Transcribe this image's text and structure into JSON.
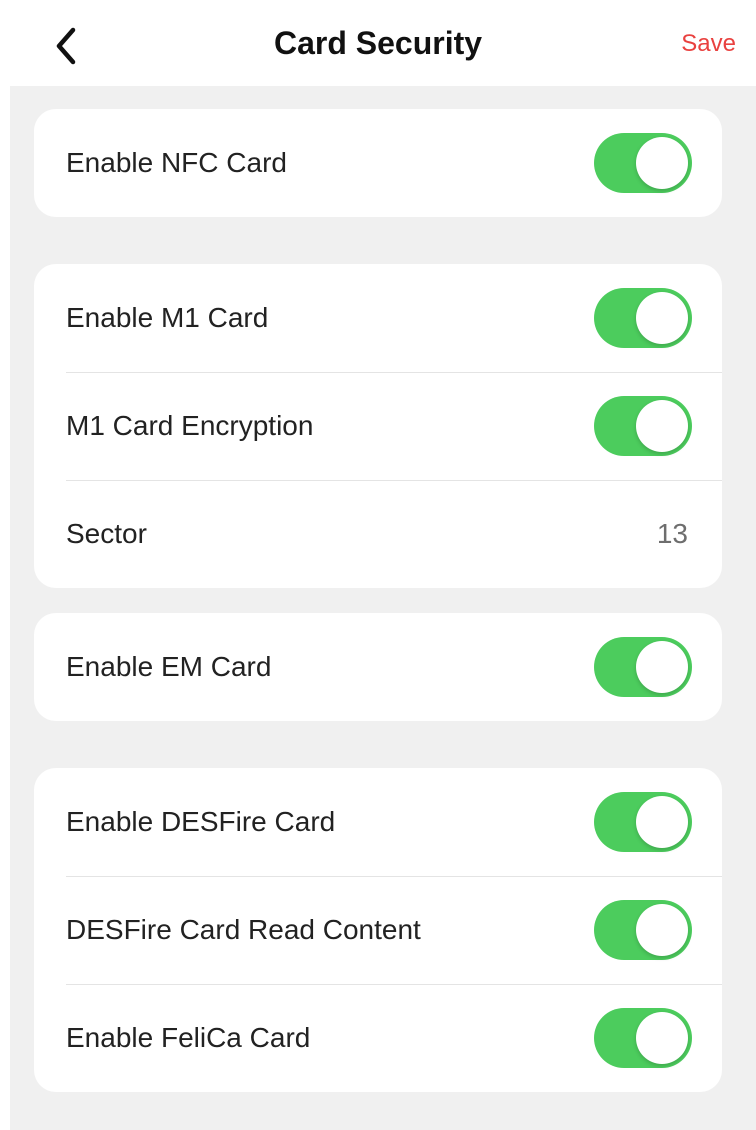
{
  "header": {
    "title": "Card Security",
    "save_label": "Save",
    "back_icon": "chevron-left-icon"
  },
  "colors": {
    "accent_green": "#4ccc5d",
    "save_red": "#e9413f",
    "background_gray": "#f0f0f0"
  },
  "groups": [
    {
      "rows": [
        {
          "label": "Enable NFC Card",
          "type": "toggle",
          "on": true
        }
      ]
    },
    {
      "rows": [
        {
          "label": "Enable M1 Card",
          "type": "toggle",
          "on": true
        },
        {
          "label": "M1 Card Encryption",
          "type": "toggle",
          "on": true
        },
        {
          "label": "Sector",
          "type": "value",
          "value": "13"
        }
      ]
    },
    {
      "rows": [
        {
          "label": "Enable EM Card",
          "type": "toggle",
          "on": true
        }
      ]
    },
    {
      "rows": [
        {
          "label": "Enable DESFire Card",
          "type": "toggle",
          "on": true
        },
        {
          "label": "DESFire Card Read Content",
          "type": "toggle",
          "on": true
        },
        {
          "label": "Enable FeliCa Card",
          "type": "toggle",
          "on": true
        }
      ]
    }
  ]
}
